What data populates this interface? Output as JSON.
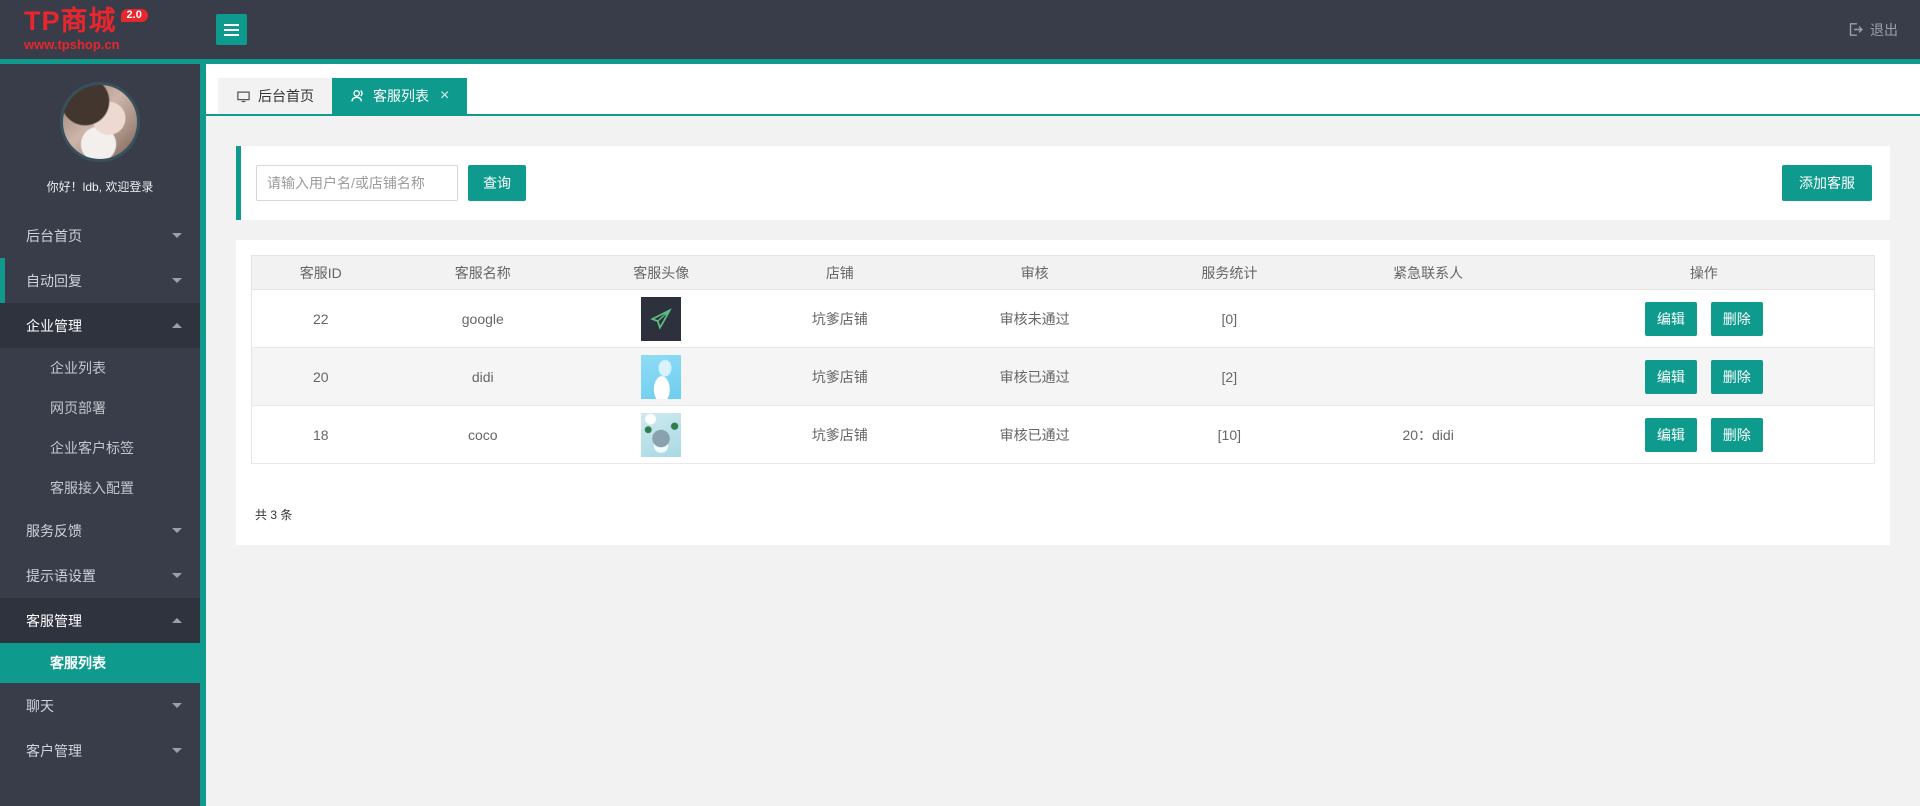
{
  "colors": {
    "accent": "#0e9b8d",
    "header_bg": "#393d49",
    "menu_expanded_bg": "#2f333e",
    "logo_red": "#e7262e",
    "row_alt": "#f5f5f5"
  },
  "header": {
    "logo_title": "TP商城",
    "logo_badge": "2.0",
    "logo_subtitle": "www.tpshop.cn",
    "logout_label": "退出"
  },
  "sidebar": {
    "greeting": "你好！ldb, 欢迎登录",
    "menu": [
      {
        "label": "后台首页"
      },
      {
        "label": "自动回复"
      },
      {
        "label": "企业管理"
      },
      {
        "label": "服务反馈"
      },
      {
        "label": "提示语设置"
      },
      {
        "label": "客服管理"
      },
      {
        "label": "聊天"
      },
      {
        "label": "客户管理"
      }
    ],
    "submenu_enterprise": [
      {
        "label": "企业列表"
      },
      {
        "label": "网页部署"
      },
      {
        "label": "企业客户标签"
      },
      {
        "label": "客服接入配置"
      }
    ],
    "submenu_service": [
      {
        "label": "客服列表"
      }
    ]
  },
  "tabs": [
    {
      "label": "后台首页"
    },
    {
      "label": "客服列表",
      "close_glyph": "×"
    }
  ],
  "toolbar": {
    "search_placeholder": "请输入用户名/或店铺名称",
    "search_button": "查询",
    "add_button": "添加客服"
  },
  "table": {
    "columns": [
      "客服ID",
      "客服名称",
      "客服头像",
      "店铺",
      "审核",
      "服务统计",
      "紧急联系人",
      "操作"
    ],
    "rows": [
      {
        "id": "22",
        "name": "google",
        "avatar": "dark-paper-plane",
        "shop": "坑爹店铺",
        "audit": "审核未通过",
        "stats": "[0]",
        "contact": ""
      },
      {
        "id": "20",
        "name": "didi",
        "avatar": "blue-figure",
        "shop": "坑爹店铺",
        "audit": "审核已通过",
        "stats": "[2]",
        "contact": ""
      },
      {
        "id": "18",
        "name": "coco",
        "avatar": "totoro-blue",
        "shop": "坑爹店铺",
        "audit": "审核已通过",
        "stats": "[10]",
        "contact": "20：didi"
      }
    ],
    "edit_label": "编辑",
    "delete_label": "删除",
    "footer_total": "共 3 条"
  }
}
